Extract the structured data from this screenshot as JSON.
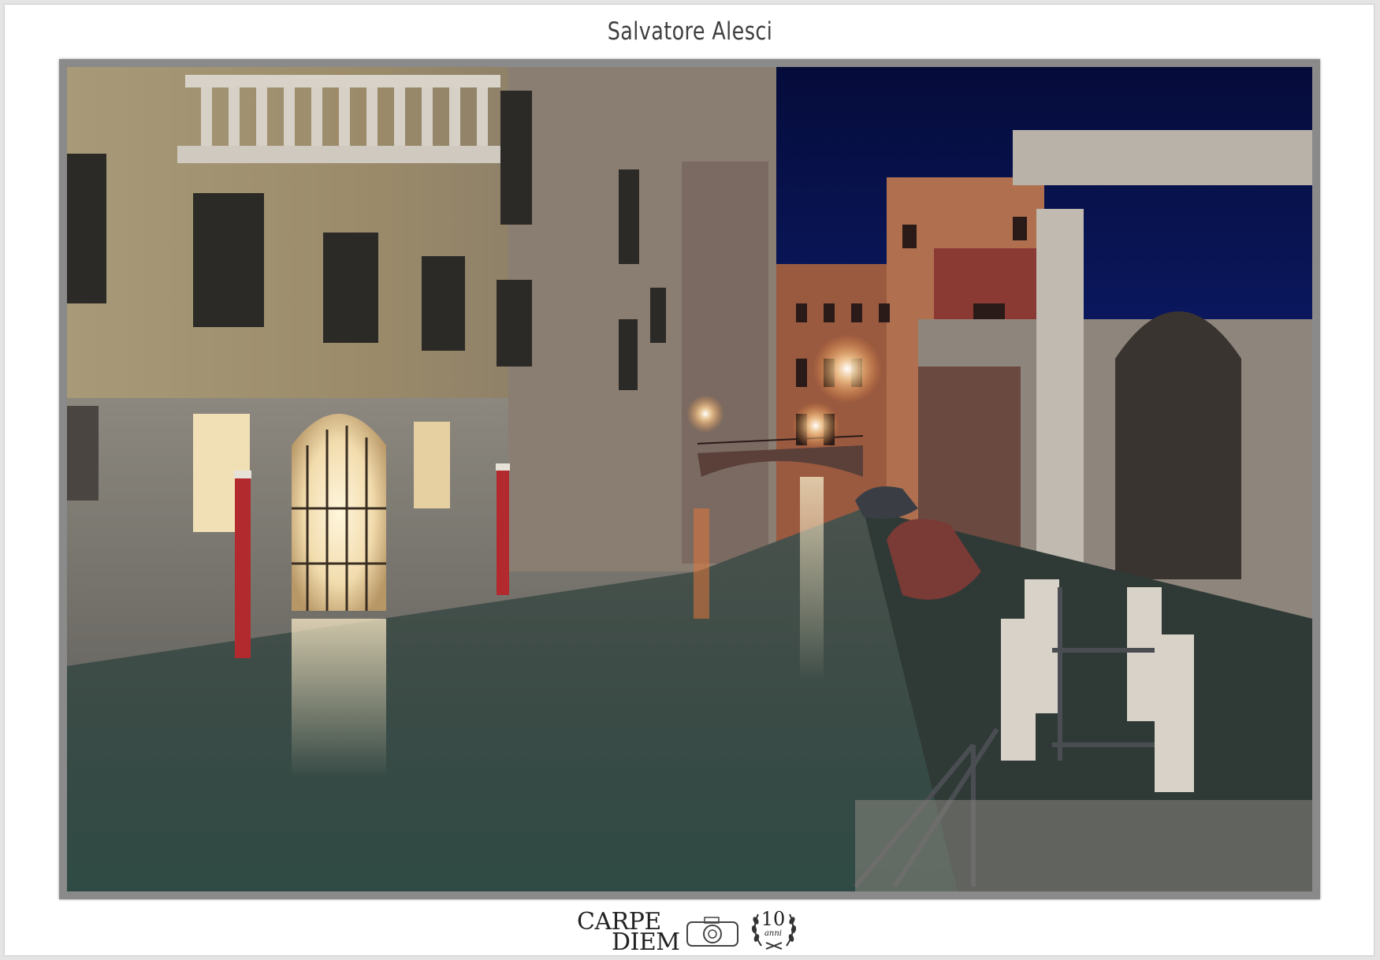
{
  "header": {
    "photographer": "Salvatore Alesci"
  },
  "footer": {
    "logo_word_1": "CARPE",
    "logo_word_2": "DIEM",
    "logo_anniversary_number": "10",
    "logo_anniversary_word": "anni"
  },
  "colors": {
    "night_sky": "#0a1450",
    "canal_water": "#3a4e48",
    "mooring_pole": "#b22a2e",
    "lamp_glow": "#fff2cf",
    "title_text": "#3f3f3f"
  },
  "icons": {
    "logo_camera": "camera-icon",
    "logo_laurel": "laurel-wreath-icon"
  }
}
